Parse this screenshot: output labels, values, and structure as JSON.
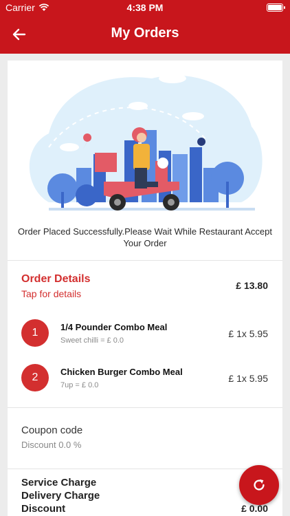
{
  "status_bar": {
    "carrier": "Carrier",
    "time": "4:38 PM"
  },
  "navbar": {
    "title": "My Orders",
    "back_icon": "arrow-left-icon"
  },
  "illustration": {
    "name": "delivery-scooter-illustration"
  },
  "status_message": "Order Placed Successfully.Please Wait While Restaurant Accept Your Order",
  "order": {
    "title": "Order Details",
    "subtitle": "Tap for details",
    "total": "£ 13.80",
    "items": [
      {
        "index": "1",
        "name": "1/4 Pounder Combo Meal",
        "option": "Sweet chilli  = £ 0.0",
        "price": "£ 1x 5.95"
      },
      {
        "index": "2",
        "name": "Chicken Burger Combo Meal",
        "option": "7up = £ 0.0",
        "price": "£ 1x 5.95"
      }
    ]
  },
  "coupon": {
    "label": "Coupon code",
    "value": "Discount 0.0 %"
  },
  "charges": [
    {
      "label": "Service Charge",
      "value": "£"
    },
    {
      "label": "Delivery Charge",
      "value": "£"
    },
    {
      "label": "Discount",
      "value": "£ 0.00"
    }
  ],
  "fab": {
    "icon": "refresh-icon"
  },
  "colors": {
    "primary": "#c8161c",
    "accent": "#d32f2f"
  }
}
